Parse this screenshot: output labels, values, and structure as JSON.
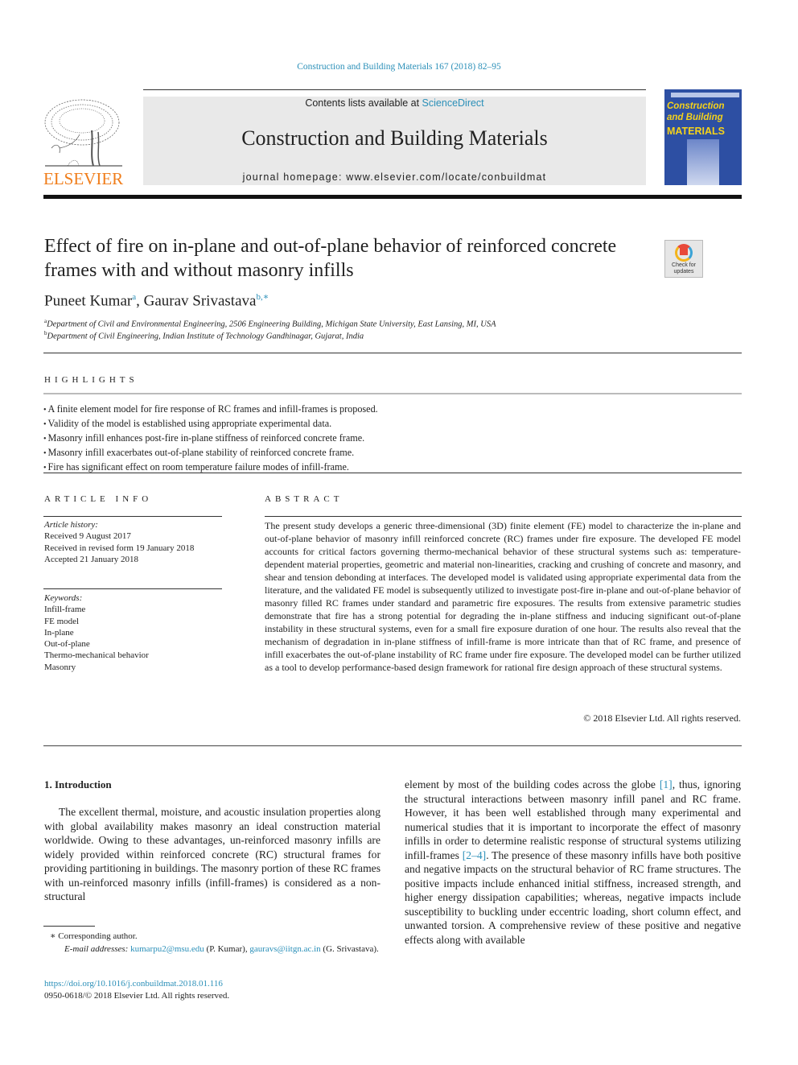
{
  "citation": "Construction and Building Materials 167 (2018) 82–95",
  "header": {
    "publisher_logo_text": "ELSEVIER",
    "contents_prefix": "Contents lists available at ",
    "contents_link": "ScienceDirect",
    "journal_name": "Construction and Building Materials",
    "homepage_line": "journal homepage: www.elsevier.com/locate/conbuildmat",
    "cover": {
      "title_line1": "Construction",
      "title_line2": "and Building",
      "title_line3": "MATERIALS"
    }
  },
  "check_updates": {
    "line1": "Check for",
    "line2": "updates"
  },
  "article": {
    "title": "Effect of fire on in-plane and out-of-plane behavior of reinforced concrete frames with and without masonry infills",
    "authors": [
      {
        "name": "Puneet Kumar",
        "sup": "a"
      },
      {
        "name": "Gaurav Srivastava",
        "sup": "b,∗"
      }
    ],
    "author_separator": ", ",
    "affiliations": [
      {
        "key": "a",
        "text": "Department of Civil and Environmental Engineering, 2506 Engineering Building, Michigan State University, East Lansing, MI, USA"
      },
      {
        "key": "b",
        "text": "Department of Civil Engineering, Indian Institute of Technology Gandhinagar, Gujarat, India"
      }
    ]
  },
  "highlights": {
    "heading": "HIGHLIGHTS",
    "items": [
      "A finite element model for fire response of RC frames and infill-frames is proposed.",
      "Validity of the model is established using appropriate experimental data.",
      "Masonry infill enhances post-fire in-plane stiffness of reinforced concrete frame.",
      "Masonry infill exacerbates out-of-plane stability of reinforced concrete frame.",
      "Fire has significant effect on room temperature failure modes of infill-frame."
    ]
  },
  "article_info": {
    "heading": "ARTICLE INFO",
    "history_label": "Article history:",
    "history": [
      "Received 9 August 2017",
      "Received in revised form 19 January 2018",
      "Accepted 21 January 2018"
    ],
    "keywords_label": "Keywords:",
    "keywords": [
      "Infill-frame",
      "FE model",
      "In-plane",
      "Out-of-plane",
      "Thermo-mechanical behavior",
      "Masonry"
    ]
  },
  "abstract": {
    "heading": "ABSTRACT",
    "text": "The present study develops a generic three-dimensional (3D) finite element (FE) model to characterize the in-plane and out-of-plane behavior of masonry infill reinforced concrete (RC) frames under fire expo­sure. The developed FE model accounts for critical factors governing thermo-mechanical behavior of these structural systems such as: temperature-dependent material properties, geometric and material non-linearities, cracking and crushing of concrete and masonry, and shear and tension debonding at interfaces. The developed model is validated using appropriate experimental data from the literature, and the validated FE model is subsequently utilized to investigate post-fire in-plane and out-of-plane behavior of masonry filled RC frames under standard and parametric fire exposures. The results from extensive parametric studies demonstrate that fire has a strong potential for degrading the in-plane stiff­ness and inducing significant out-of-plane instability in these structural systems, even for a small fire exposure duration of one hour. The results also reveal that the mechanism of degradation in in-plane stiffness of infill-frame is more intricate than that of RC frame, and presence of infill exacerbates the out-of-plane instability of RC frame under fire exposure. The developed model can be further utilized as a tool to develop performance-based design framework for rational fire design approach of these struc­tural systems.",
    "copyright": "© 2018 Elsevier Ltd. All rights reserved."
  },
  "introduction": {
    "heading": "1. Introduction",
    "left_text": "The excellent thermal, moisture, and acoustic insulation prop­erties along with global availability makes masonry an ideal con­struction material worldwide. Owing to these advantages, un-reinforced masonry infills are widely provided within reinforced concrete (RC) structural frames for providing partitioning in build­ings. The masonry portion of these RC frames with un-reinforced masonry infills (infill-frames) is considered as a non-structural",
    "right_segments": [
      "element by most of the building codes across the globe ",
      "[1]",
      ", thus, ignoring the structural interactions between masonry infill panel and RC frame. However, it has been well established through many experimental and numerical studies that it is important to incorpo­rate the effect of masonry infills in order to determine realistic response of structural systems utilizing infill-frames ",
      "[2–4]",
      ". The presence of these masonry infills have both positive and negative impacts on the structural behavior of RC frame structures. The pos­itive impacts include enhanced initial stiffness, increased strength, and higher energy dissipation capabilities; whereas, negative impacts include susceptibility to buckling under eccentric loading, short column effect, and unwanted torsion. A comprehensive review of these positive and negative effects along with available"
    ]
  },
  "footnotes": {
    "corresponding": "∗ Corresponding author.",
    "email_label": "E-mail addresses:",
    "email1": "kumarpu2@msu.edu",
    "email1_owner": " (P. Kumar), ",
    "email2": "gauravs@iitgn.ac.in",
    "email2_owner": " (G. Srivastava).",
    "doi": "https://doi.org/10.1016/j.conbuildmat.2018.01.116",
    "issn": "0950-0618/© 2018 Elsevier Ltd. All rights reserved."
  },
  "colors": {
    "link": "#2a8fb8",
    "elsevier_orange": "#f07d1a",
    "cover_blue": "#2d4fa3",
    "cover_yellow": "#f5d21a"
  }
}
